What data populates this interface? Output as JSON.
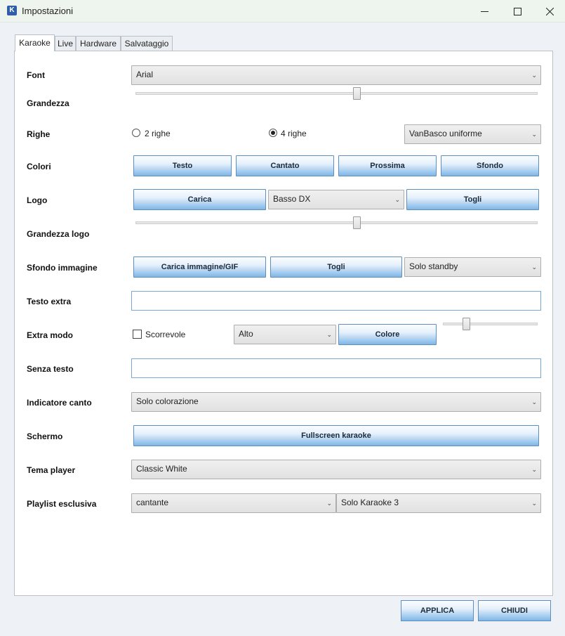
{
  "window": {
    "title": "Impostazioni",
    "app_icon": "K"
  },
  "tabs": [
    {
      "label": "Karaoke",
      "active": true
    },
    {
      "label": "Live",
      "active": false
    },
    {
      "label": "Hardware",
      "active": false
    },
    {
      "label": "Salvataggio",
      "active": false
    }
  ],
  "icons": {
    "minimize": "minimize-icon",
    "maximize": "maximize-icon",
    "close": "close-icon",
    "dropdown": "chevron-down-icon"
  },
  "form": {
    "font": {
      "label": "Font",
      "value": "Arial"
    },
    "grandezza": {
      "label": "Grandezza",
      "slider_fraction": 0.55
    },
    "righe": {
      "label": "Righe",
      "option_2": "2 righe",
      "option_4": "4 righe",
      "selected": "4 righe",
      "style_value": "VanBasco uniforme"
    },
    "colori": {
      "label": "Colori",
      "testo": "Testo",
      "cantato": "Cantato",
      "prossima": "Prossima",
      "sfondo": "Sfondo"
    },
    "logo": {
      "label": "Logo",
      "carica": "Carica",
      "position_value": "Basso DX",
      "togli": "Togli"
    },
    "grandezza_logo": {
      "label": "Grandezza logo",
      "slider_fraction": 0.55
    },
    "sfondo_immagine": {
      "label": "Sfondo immagine",
      "carica": "Carica immagine/GIF",
      "togli": "Togli",
      "mode_value": "Solo standby"
    },
    "testo_extra": {
      "label": "Testo extra",
      "value": ""
    },
    "extra_modo": {
      "label": "Extra modo",
      "checkbox_label": "Scorrevole",
      "checked": false,
      "position_value": "Alto",
      "colore": "Colore",
      "slider_fraction": 0.25
    },
    "senza_testo": {
      "label": "Senza testo",
      "value": ""
    },
    "indicatore_canto": {
      "label": "Indicatore canto",
      "value": "Solo colorazione"
    },
    "schermo": {
      "label": "Schermo",
      "button": "Fullscreen karaoke"
    },
    "tema_player": {
      "label": "Tema player",
      "value": "Classic White"
    },
    "playlist_esclusiva": {
      "label": "Playlist esclusiva",
      "field_value": "cantante",
      "playlist_value": "Solo Karaoke 3"
    }
  },
  "footer": {
    "applica": "APPLICA",
    "chiudi": "CHIUDI"
  }
}
